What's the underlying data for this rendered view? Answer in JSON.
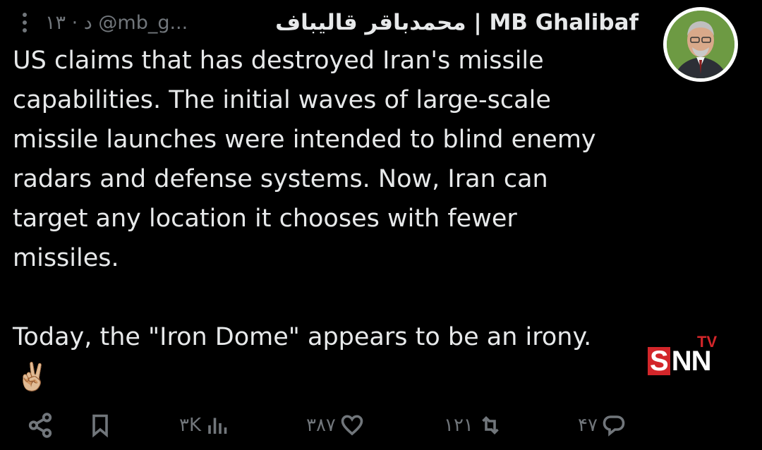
{
  "header": {
    "name": "محمدباقر قالیباف | MB Ghalibaf",
    "handle": "@mb_g...",
    "time": "۱۳ · د"
  },
  "tweet": {
    "text": "US claims that has destroyed Iran's missile\ncapabilities. The initial waves of large-scale\nmissile launches were intended to blind enemy\nradars and defense systems. Now, Iran can\ntarget any location it chooses with fewer\nmissiles.\n\nToday, the \"Iron Dome\" appears to be an irony.",
    "emoji": "✌🏼"
  },
  "watermark": {
    "s": "S",
    "nn": "NN",
    "tv": "TV"
  },
  "actions": {
    "views": "۳K",
    "likes": "۳۸۷",
    "retweets": "۱۲۱",
    "replies": "۴۷"
  },
  "colors": {
    "background": "#000000",
    "text": "#e7e9ea",
    "muted": "#71767b",
    "brand_red": "#d3262a"
  }
}
